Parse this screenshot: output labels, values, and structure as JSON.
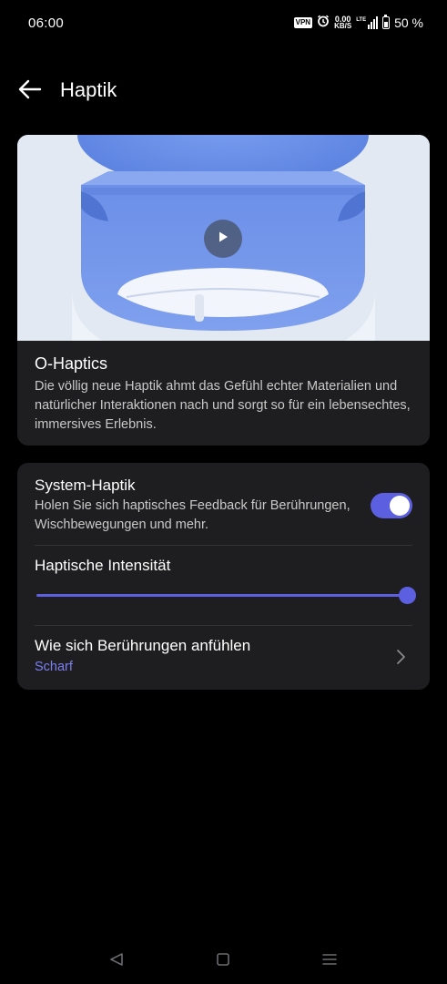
{
  "status_bar": {
    "time": "06:00",
    "vpn": "VPN",
    "speed_value": "0.00",
    "speed_unit": "KB/S",
    "network": "LTE",
    "battery": "50 %"
  },
  "header": {
    "title": "Haptik"
  },
  "video_card": {
    "title": "O-Haptics",
    "description": "Die völlig neue Haptik ahmt das Gefühl echter Materialien und natürlicher Interaktionen nach und sorgt so für ein lebensechtes,  immersives Erlebnis."
  },
  "settings": {
    "system_haptik": {
      "title": "System-Haptik",
      "subtitle": "Holen Sie sich haptisches Feedback für Berührungen,  Wischbewegungen und mehr.",
      "enabled": true
    },
    "intensity": {
      "title": "Haptische Intensität",
      "level_fraction": 1.0
    },
    "touch_feel": {
      "title": "Wie sich Berührungen anfühlen",
      "value": "Scharf"
    }
  },
  "colors": {
    "accent": "#5b5fe0",
    "card_bg": "#1e1e20",
    "background": "#000000"
  },
  "icons": {
    "back": "arrow-left-icon",
    "play": "play-icon",
    "chevron": "chevron-right-icon",
    "nav_back": "triangle-back-icon",
    "nav_home": "square-home-icon",
    "nav_recent": "menu-recent-icon"
  }
}
